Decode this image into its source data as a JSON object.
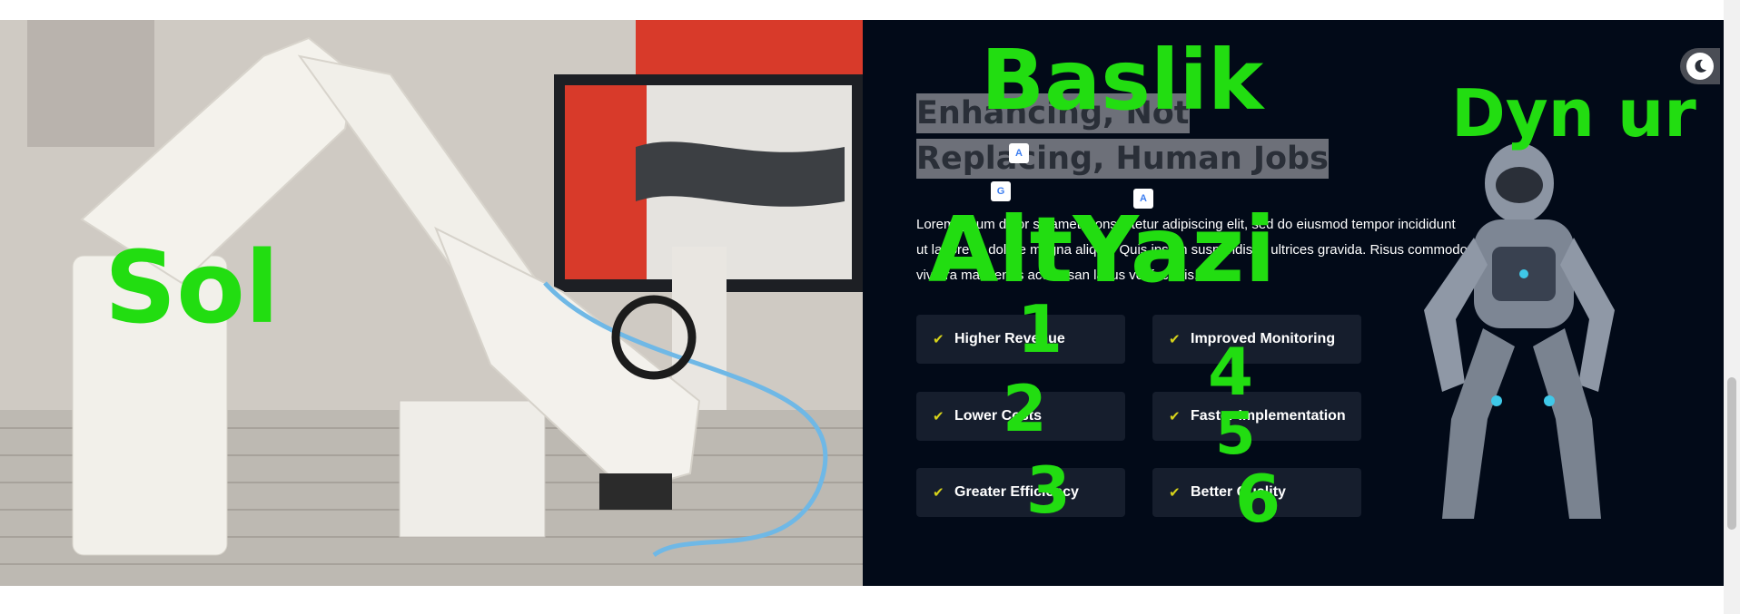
{
  "hero": {
    "heading": "Enhancing, Not Replacing, Human Jobs",
    "paragraph": "Lorem ipsum dolor sit amet, consectetur adipiscing elit, sed do eiusmod tempor incididunt ut labore et dolore magna aliqua. Quis ipsum suspendisse ultrices gravida. Risus commodo viverra maecenas accumsan lacus vel facilisis.",
    "features": [
      {
        "label": "Higher Revenue"
      },
      {
        "label": "Improved Monitoring"
      },
      {
        "label": "Lower Costs"
      },
      {
        "label": "Faster Implementation"
      },
      {
        "label": "Greater Efficiency"
      },
      {
        "label": "Better Quality"
      }
    ]
  },
  "annotations": {
    "baslik": "Baslik",
    "dynar": "Dyn ur",
    "sol": "Sol",
    "altyazi": "AltYazi",
    "n1": "1",
    "n2": "2",
    "n3": "3",
    "n4": "4",
    "n5": "5",
    "n6": "6"
  },
  "translate_badges": [
    "A",
    "G",
    "A"
  ],
  "colors": {
    "panel_bg": "#020a18",
    "feature_bg": "#161e2d",
    "check": "#d6d21a",
    "annotation": "#22dd11"
  },
  "icons": {
    "check": "check-icon",
    "theme": "moon-icon",
    "translate": "translate-icon"
  }
}
